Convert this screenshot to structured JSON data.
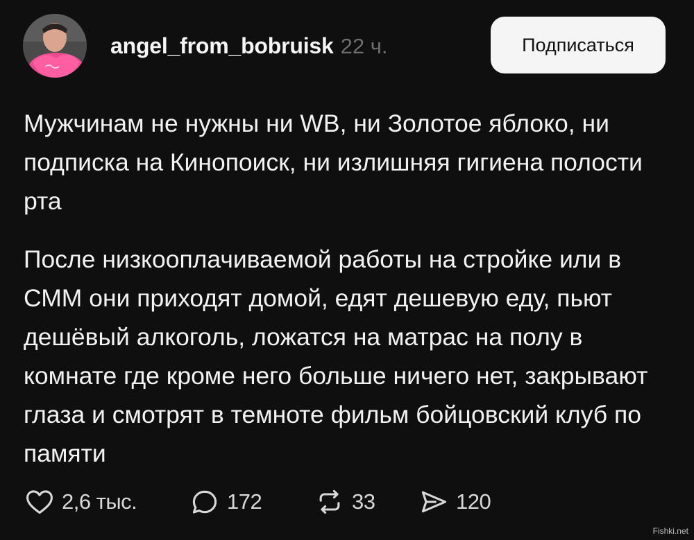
{
  "post": {
    "author": {
      "username": "angel_from_bobruisk",
      "time": "22 ч."
    },
    "subscribe_label": "Подписаться",
    "paragraphs": [
      "Мужчинам не нужны ни WB, ни Золотое яблоко, ни подписка на Кинопоиск, ни излишняя гигиена полости рта",
      "После низкооплачиваемой работы на стройке или в СММ они приходят домой, едят дешевую еду, пьют дешёвый алкоголь, ложатся на матрас на полу в комнате где кроме него больше ничего нет, закрывают глаза и смотрят в темноте фильм бойцовский клуб по памяти"
    ],
    "actions": {
      "likes": "2,6 тыс.",
      "comments": "172",
      "reposts": "33",
      "shares": "120"
    }
  },
  "watermark": "Fishki.net",
  "icons": {
    "like": "heart-icon",
    "comment": "comment-bubble-icon",
    "repost": "repost-arrows-icon",
    "share": "send-arrow-icon"
  }
}
